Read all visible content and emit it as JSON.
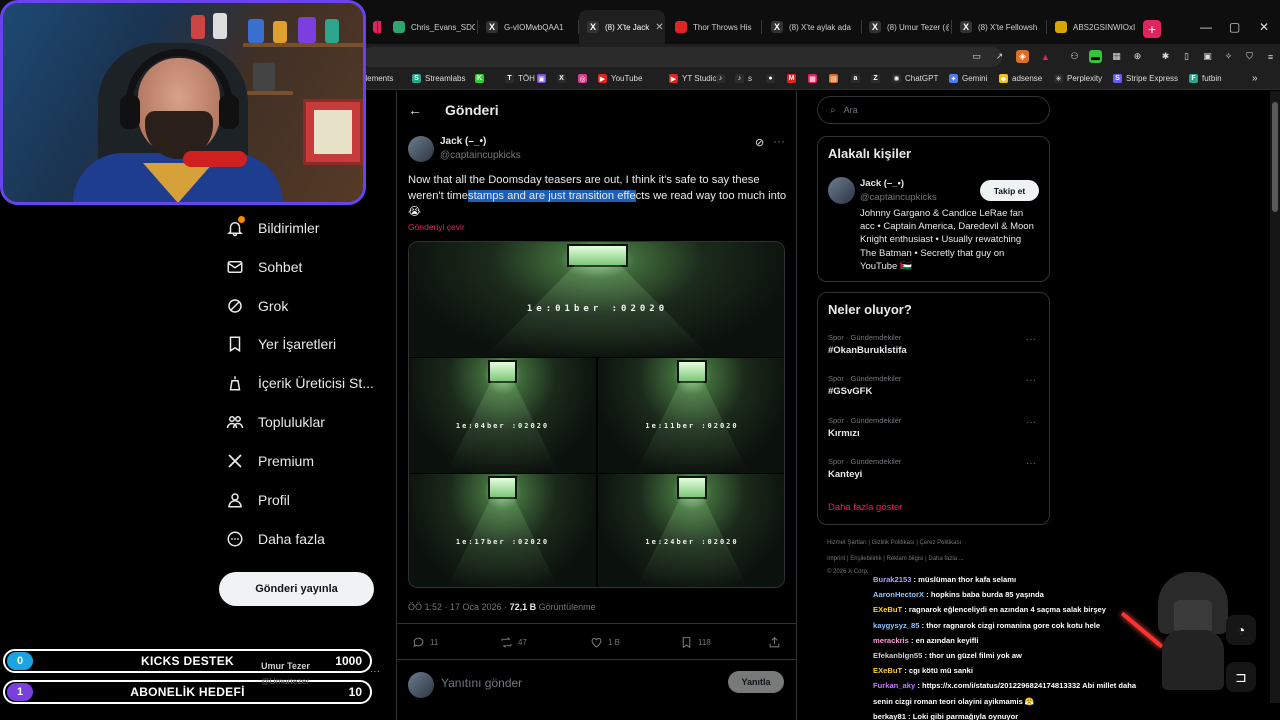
{
  "browser": {
    "tabs": [
      {
        "label": "p",
        "color": "#e0245e",
        "active": false
      },
      {
        "label": "Chris_Evans_SDC",
        "color": "#2ea56b",
        "active": false
      },
      {
        "label": "G-vIOMwbQAA1",
        "color": "#333",
        "active": false
      },
      {
        "label": "(8) X'te Jack",
        "color": "#333",
        "active": true
      },
      {
        "label": "Thor Throws His",
        "color": "#e02424",
        "active": false
      },
      {
        "label": "(8) X'te aylak ada",
        "color": "#333",
        "active": false
      },
      {
        "label": "(8) Umur Tezer (@",
        "color": "#333",
        "active": false
      },
      {
        "label": "(8) X'te Fellowsh",
        "color": "#333",
        "active": false
      },
      {
        "label": "ABS2GSINWIOxI",
        "color": "#d9a400",
        "active": false
      }
    ],
    "new_tab_label": "+",
    "window_controls": [
      "—",
      "▢",
      "✕"
    ],
    "bookmarks": [
      {
        "label": "Elements",
        "color": "#1f1f1f",
        "glyph": ""
      },
      {
        "label": "Streamlabs",
        "color": "#2ba58b",
        "glyph": "S"
      },
      {
        "label": "",
        "color": "#33cc33",
        "glyph": "K"
      },
      {
        "label": "TÖH",
        "color": "#2b2b2b",
        "glyph": "T"
      },
      {
        "label": "",
        "color": "#7b4fe0",
        "glyph": "▣"
      },
      {
        "label": "",
        "color": "#2b2b2b",
        "glyph": "X"
      },
      {
        "label": "",
        "color": "#d63a8a",
        "glyph": "◎"
      },
      {
        "label": "YouTube",
        "color": "#e02424",
        "glyph": "▶"
      },
      {
        "label": "YT Studio",
        "color": "#e02424",
        "glyph": "▶"
      },
      {
        "label": "",
        "color": "#2b2b2b",
        "glyph": "♪"
      },
      {
        "label": "s",
        "color": "#2b2b2b",
        "glyph": "♪"
      },
      {
        "label": "",
        "color": "#2b2b2b",
        "glyph": "●"
      },
      {
        "label": "",
        "color": "#e02424",
        "glyph": "M"
      },
      {
        "label": "",
        "color": "#e0245e",
        "glyph": "▦"
      },
      {
        "label": "",
        "color": "#d96f2a",
        "glyph": "▤"
      },
      {
        "label": "",
        "color": "#2b2b2b",
        "glyph": "a"
      },
      {
        "label": "",
        "color": "#2b2b2b",
        "glyph": "Z"
      },
      {
        "label": "ChatGPT",
        "color": "#2b2b2b",
        "glyph": "✺"
      },
      {
        "label": "Gemini",
        "color": "#4a7cf0",
        "glyph": "✦"
      },
      {
        "label": "adsense",
        "color": "#f0c020",
        "glyph": "◆"
      },
      {
        "label": "Perplexity",
        "color": "#2b2b2b",
        "glyph": "✳"
      },
      {
        "label": "Stripe Express",
        "color": "#6a5cf0",
        "glyph": "S"
      },
      {
        "label": "futbin",
        "color": "#2ba58b",
        "glyph": "F"
      }
    ],
    "bookmarks_overflow": "»"
  },
  "nav": {
    "items": [
      {
        "label": "Bildirimler",
        "icon": "bell-icon"
      },
      {
        "label": "Sohbet",
        "icon": "mail-icon"
      },
      {
        "label": "Grok",
        "icon": "grok-icon"
      },
      {
        "label": "Yer İşaretleri",
        "icon": "bookmark-icon"
      },
      {
        "label": "İçerik Üreticisi St...",
        "icon": "creator-studio-icon"
      },
      {
        "label": "Topluluklar",
        "icon": "communities-icon"
      },
      {
        "label": "Premium",
        "icon": "x-logo-icon"
      },
      {
        "label": "Profil",
        "icon": "profile-icon"
      },
      {
        "label": "Daha fazla",
        "icon": "more-circle-icon"
      }
    ],
    "notification_dot_color": "#f58a07",
    "post_button": "Gönderi yayınla"
  },
  "main": {
    "header_title": "Gönderi",
    "tweet": {
      "author": "Jack (–_•)",
      "handle": "@captaincupkicks",
      "text_before": "Now that all the Doomsday teasers are out, I think it's safe to say these weren't time",
      "text_selected": "stamps and are just transition effe",
      "text_after": "cts we read way too much into 😭",
      "translate": "Gönderiyi çevir",
      "frames": [
        {
          "stamp": "1e:01ber :02020"
        },
        {
          "stamp": "1e:04ber :02020"
        },
        {
          "stamp": "1e:11ber :02020"
        },
        {
          "stamp": "1e:17ber :02020"
        },
        {
          "stamp": "1e:24ber :02020"
        }
      ],
      "time": "ÖÖ 1:52 · 17 Oca 2026 · ",
      "views_count": "72,1 B",
      "views_label": " Görüntülenme",
      "replies": "11",
      "reposts": "47",
      "likes": "1 B",
      "bookmarks": "118"
    },
    "reply_placeholder": "Yanıtını gönder",
    "reply_button": "Yanıtla"
  },
  "right": {
    "search_placeholder": "Ara",
    "relevant": {
      "title": "Alakalı kişiler",
      "name": "Jack (–_•)",
      "handle": "@captaincupkicks",
      "bio": "Johnny Gargano & Candice LeRae fan acc • Captain America, Daredevil & Moon Knight enthusiast • Usually rewatching The Batman • Secretly that guy on YouTube 🇵🇸",
      "follow": "Takip et"
    },
    "trends": {
      "title": "Neler oluyor?",
      "items": [
        {
          "category": "Spor · Gündemdekiler",
          "title": "#OkanBurukİstifa"
        },
        {
          "category": "Spor · Gündemdekiler",
          "title": "#GSvGFK"
        },
        {
          "category": "Spor · Gündemdekiler",
          "title": "Kırmızı"
        },
        {
          "category": "Spor · Gündemdekiler",
          "title": "Kanteyi"
        }
      ],
      "more": "Daha fazla göster"
    },
    "footer": [
      "Hizmet Şartları   |   Gizlilik Politikası   |   Çerez Politikası",
      "Imprint   |   Erişilebilirlik   |   Reklam bilgisi   |   Daha fazla ...",
      "© 2026 X Corp."
    ]
  },
  "stream": {
    "goals": [
      {
        "count": "0",
        "label": "KICKS DESTEK",
        "target": "1000",
        "color": "#1ca3e3"
      },
      {
        "count": "1",
        "label": "ABONELİK HEDEFİ",
        "target": "10",
        "color": "#7b3fe0"
      }
    ],
    "overlay_name": "Umur Tezer",
    "overlay_handle": "@Umurtezer",
    "chat": [
      {
        "user": "Burak2153",
        "color": "#b59cff",
        "msg": "müslüman thor kafa selamı"
      },
      {
        "user": "AaronHectorX",
        "color": "#8ec6ff",
        "msg": "hopkins baba burda 85 yaşında"
      },
      {
        "user": "EXeBuT",
        "color": "#ffcc33",
        "msg": "ragnarok eğlenceliydi en azından 4 saçma salak birşey"
      },
      {
        "user": "kaygysyz_85",
        "color": "#8ec6ff",
        "msg": "thor ragnarok cizgi romanina gore cok kotu hele"
      },
      {
        "user": "merackris",
        "color": "#ff9ad5",
        "msg": "en azından keyifli"
      },
      {
        "user": "Efekanblgn55",
        "color": "#cfcfcf",
        "msg": "thor un güzel filmi yok aw"
      },
      {
        "user": "EXeBuT",
        "color": "#ffcc33",
        "msg": "cgı kötü mü sanki"
      },
      {
        "user": "Furkan_aky",
        "color": "#c27bff",
        "msg": "https://x.com/i/status/2012296824174813332 Abi millet daha senin cizgi roman teori olayini ayikmamis 😤"
      },
      {
        "user": "berkay81",
        "color": "#ffffff",
        "msg": "Loki gibi parmağıyla oynuyor"
      }
    ]
  }
}
